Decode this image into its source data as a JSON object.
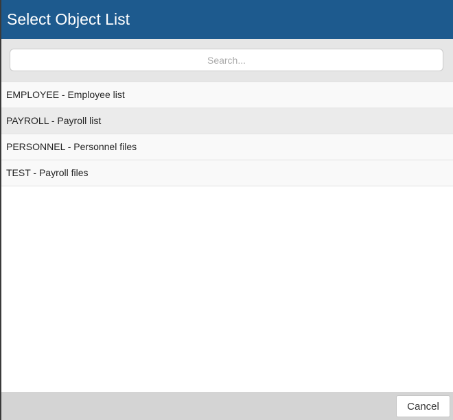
{
  "dialog": {
    "title": "Select Object List",
    "search": {
      "placeholder": "Search...",
      "value": ""
    },
    "items": [
      {
        "label": "EMPLOYEE - Employee list"
      },
      {
        "label": "PAYROLL - Payroll list"
      },
      {
        "label": "PERSONNEL - Personnel files"
      },
      {
        "label": "TEST - Payroll files"
      }
    ],
    "cancel_label": "Cancel"
  },
  "colors": {
    "title_bar": "#1d5a8e",
    "search_band": "#e6e6e6",
    "footer": "#d4d4d4",
    "highlight_row": "#ebebeb"
  }
}
